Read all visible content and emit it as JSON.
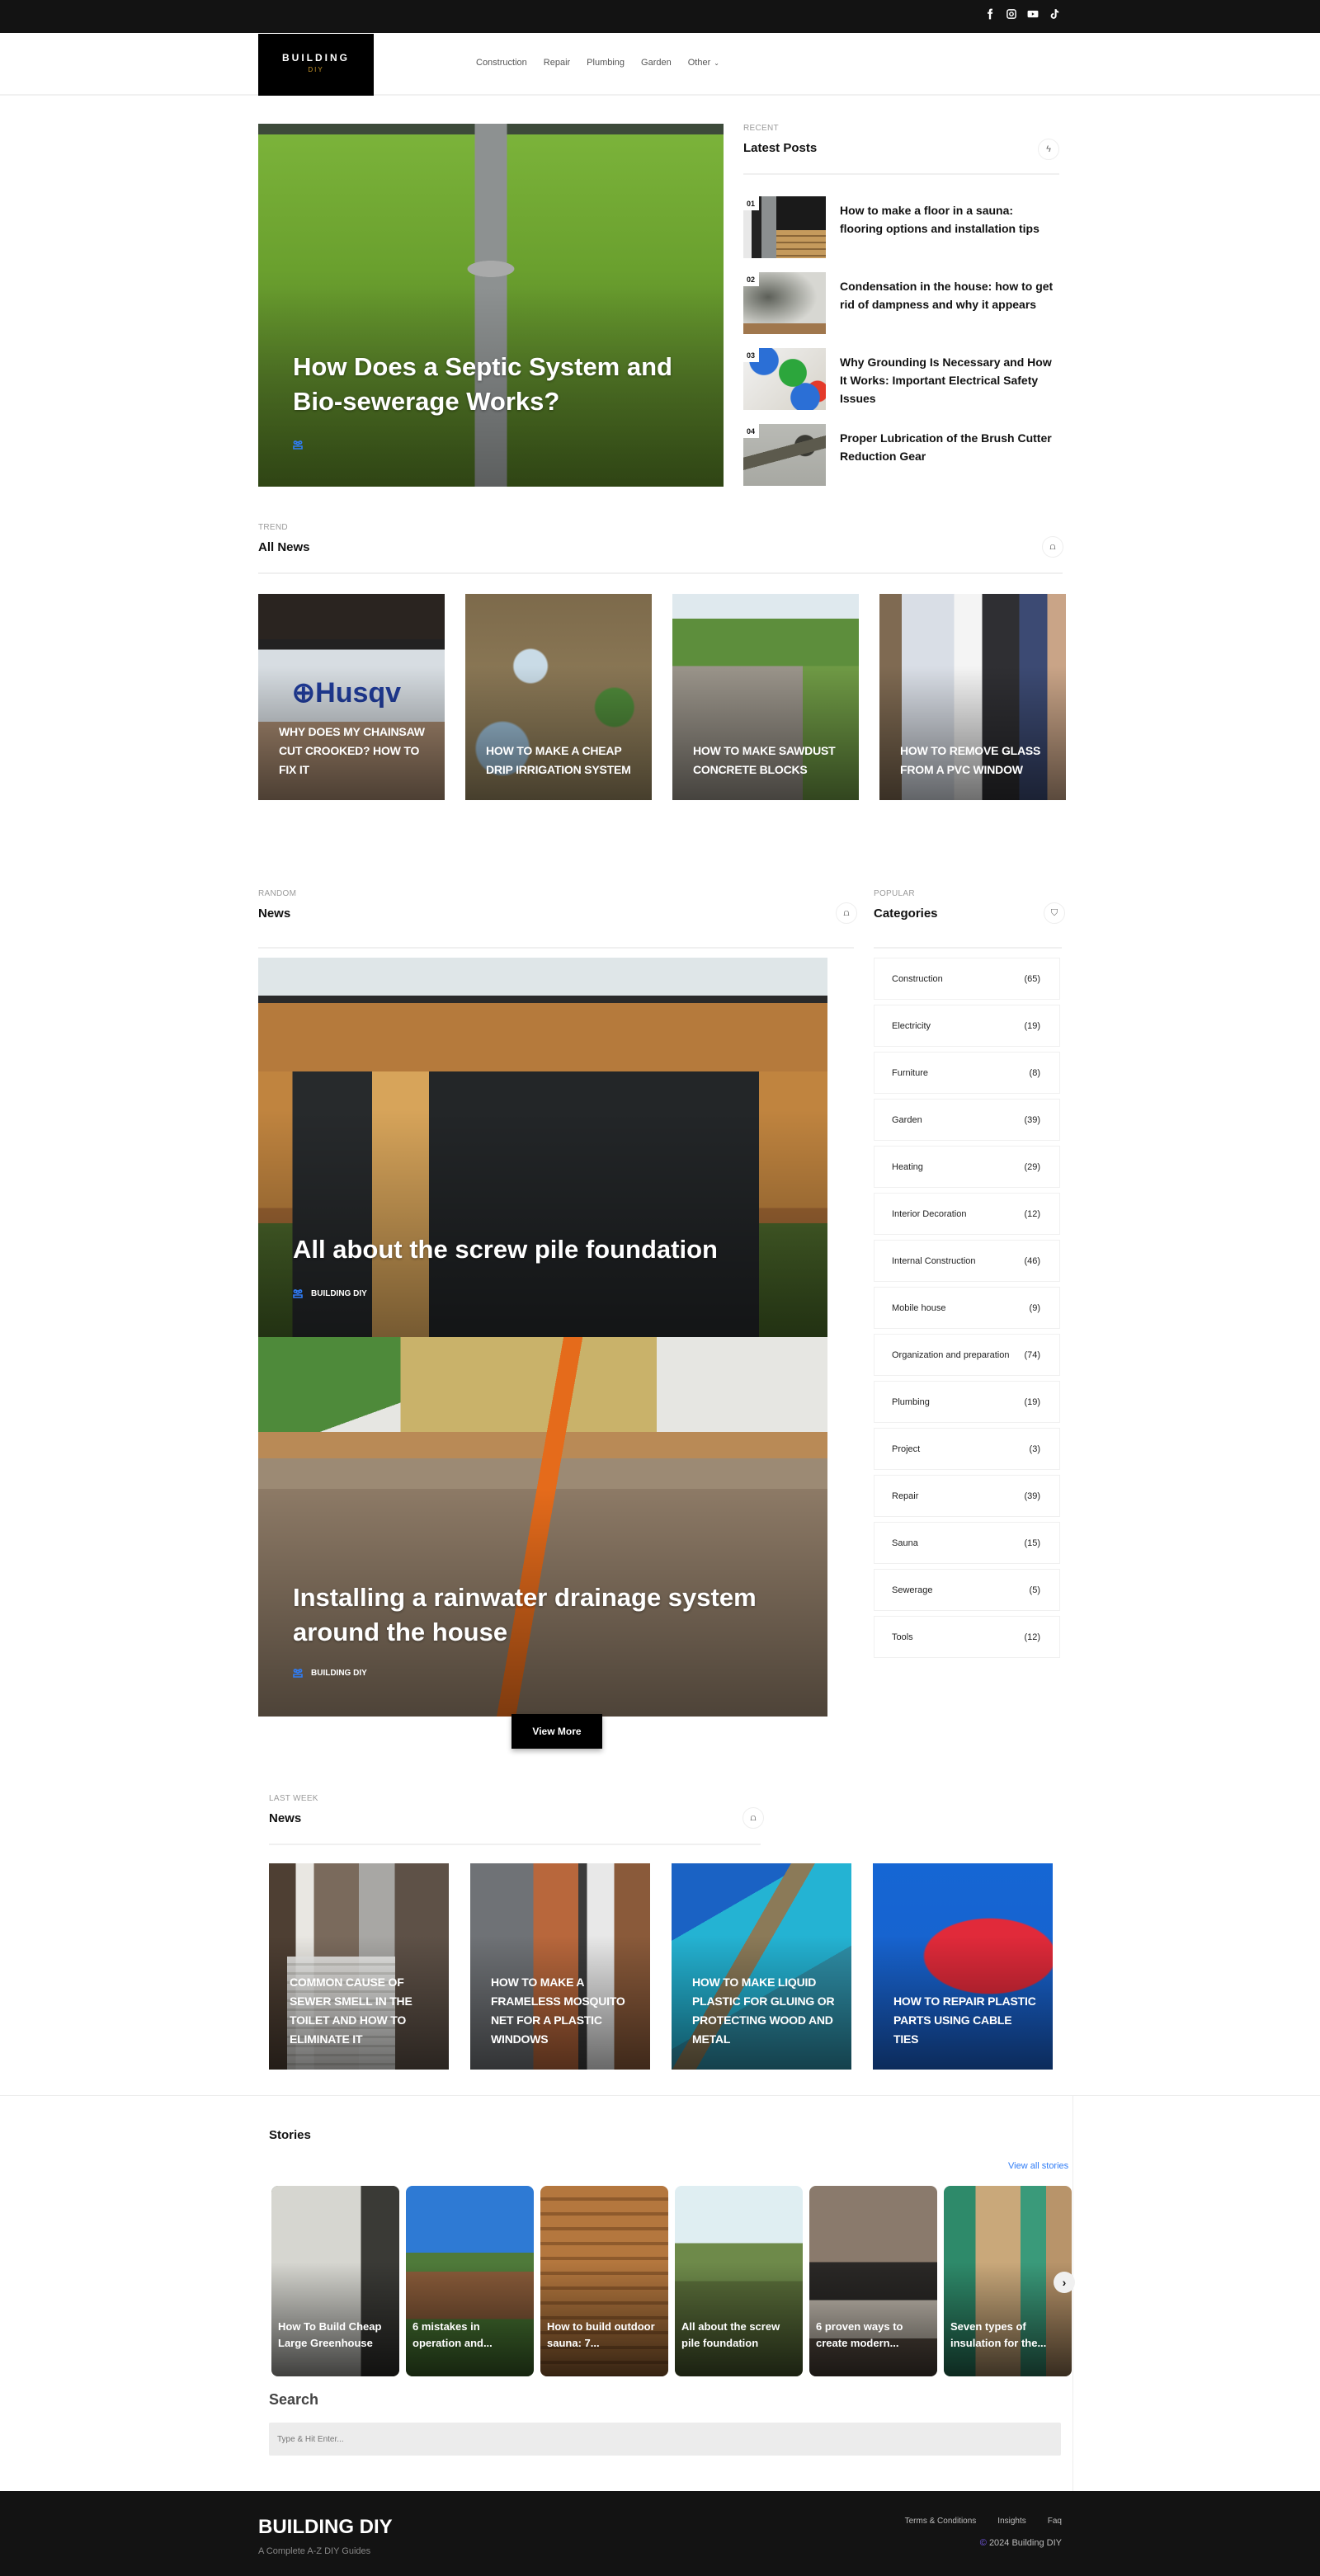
{
  "topbar": {
    "social": [
      {
        "icon": "facebook-icon"
      },
      {
        "icon": "instagram-icon"
      },
      {
        "icon": "youtube-icon"
      },
      {
        "icon": "tiktok-icon"
      }
    ]
  },
  "header": {
    "logo_line1": "BUILDING",
    "logo_line2": "DIY",
    "nav": [
      "Construction",
      "Repair",
      "Plumbing",
      "Garden",
      "Other"
    ],
    "nav_dropdown_glyph": "⌄"
  },
  "hero": {
    "title": "How Does a Septic System and Bio-sewerage Works?"
  },
  "latest": {
    "eyebrow": "RECENT",
    "title": "Latest Posts",
    "icon_glyph": "ϟ",
    "posts": [
      {
        "num": "01",
        "title": "How to make a floor in a sauna: flooring options and installation tips"
      },
      {
        "num": "02",
        "title": "Condensation in the house: how to get rid of dampness and why it appears"
      },
      {
        "num": "03",
        "title": "Why Grounding Is Necessary and How It Works: Important Electrical Safety Issues"
      },
      {
        "num": "04",
        "title": "Proper Lubrication of the Brush Cutter Reduction Gear"
      }
    ]
  },
  "trend": {
    "eyebrow": "TREND",
    "title": "All News",
    "cards": [
      {
        "title": "Why does my chainsaw cut crooked? How to fix it"
      },
      {
        "title": "How to make a cheap drip irrigation system"
      },
      {
        "title": "How to make sawdust concrete blocks"
      },
      {
        "title": "How to remove glass from a PVC window"
      }
    ]
  },
  "random": {
    "eyebrow": "RANDOM",
    "title": "News",
    "posts": [
      {
        "title": "All about the screw pile foundation",
        "author": "BUILDING DIY"
      },
      {
        "title": "Installing a rainwater drainage system around the house",
        "author": "BUILDING DIY"
      }
    ],
    "view_more": "View More"
  },
  "popular": {
    "eyebrow": "POPULAR",
    "title": "Categories",
    "categories": [
      {
        "name": "Construction",
        "count": "(65)"
      },
      {
        "name": "Electricity",
        "count": "(19)"
      },
      {
        "name": "Furniture",
        "count": "(8)"
      },
      {
        "name": "Garden",
        "count": "(39)"
      },
      {
        "name": "Heating",
        "count": "(29)"
      },
      {
        "name": "Interior Decoration",
        "count": "(12)"
      },
      {
        "name": "Internal Construction",
        "count": "(46)"
      },
      {
        "name": "Mobile house",
        "count": "(9)"
      },
      {
        "name": "Organization and preparation",
        "count": "(74)"
      },
      {
        "name": "Plumbing",
        "count": "(19)"
      },
      {
        "name": "Project",
        "count": "(3)"
      },
      {
        "name": "Repair",
        "count": "(39)"
      },
      {
        "name": "Sauna",
        "count": "(15)"
      },
      {
        "name": "Sewerage",
        "count": "(5)"
      },
      {
        "name": "Tools",
        "count": "(12)"
      }
    ]
  },
  "lastweek": {
    "eyebrow": "LAST WEEK",
    "title": "News",
    "cards": [
      {
        "title": "Common cause of sewer smell in the toilet and how to eliminate it"
      },
      {
        "title": "How to make a frameless mosquito net for a plastic windows"
      },
      {
        "title": "How to make liquid plastic for gluing or protecting wood and metal"
      },
      {
        "title": "How to repair plastic parts using cable ties"
      }
    ]
  },
  "stories": {
    "title": "Stories",
    "view_all": "View all stories",
    "next_glyph": "›",
    "items": [
      {
        "title": "How To Build Cheap Large Greenhouse"
      },
      {
        "title": "6 mistakes in operation and..."
      },
      {
        "title": "How to build outdoor sauna: 7..."
      },
      {
        "title": "All about the screw pile foundation"
      },
      {
        "title": "6 proven ways to create modern..."
      },
      {
        "title": "Seven types of insulation for the..."
      }
    ]
  },
  "search": {
    "title": "Search",
    "placeholder": "Type & Hit Enter..."
  },
  "footer": {
    "brand": "BUILDING DIY",
    "tagline": "A Complete A-Z DIY Guides",
    "links": [
      "Terms & Conditions",
      "Insights",
      "Faq"
    ],
    "copyright_symbol": "©",
    "copyright": "2024 Building DIY"
  },
  "colors": {
    "accent_blue": "#2f7cf6",
    "logo_gold": "#c8962a",
    "dark_bg": "#131313",
    "copyright_purple": "#7b5cf0"
  }
}
